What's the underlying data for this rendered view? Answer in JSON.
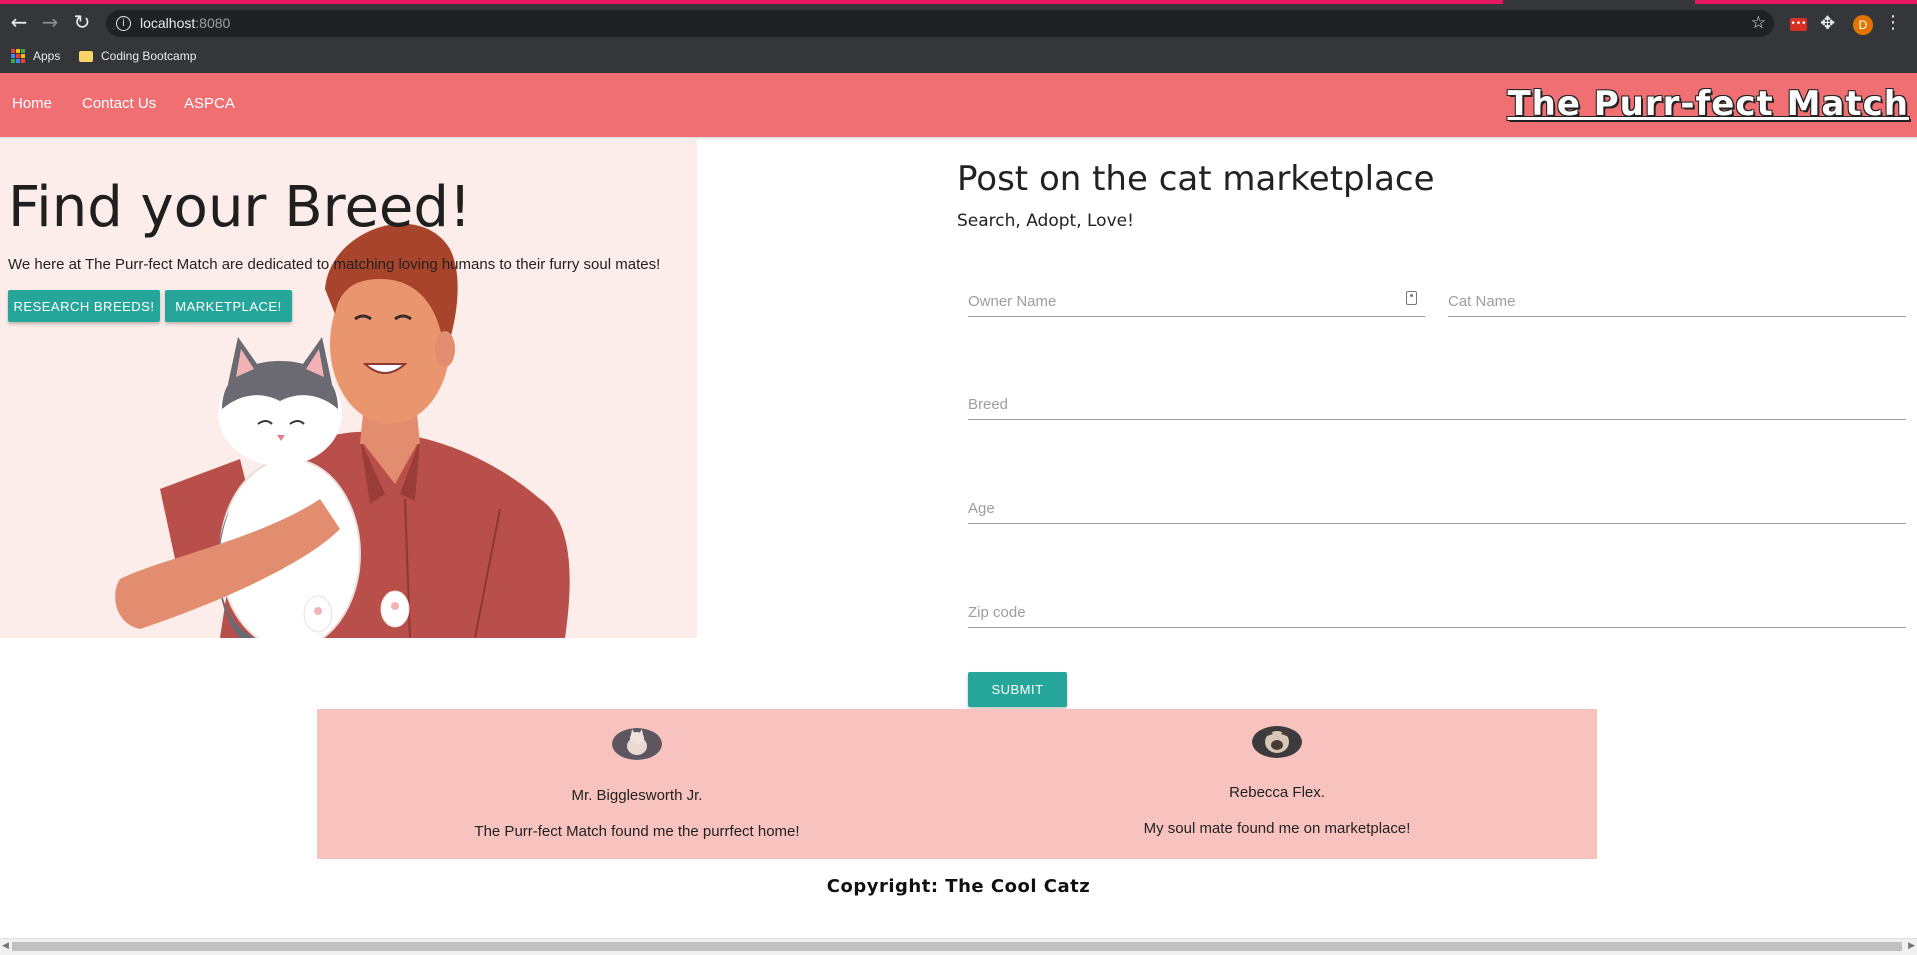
{
  "browser": {
    "url_host": "localhost",
    "url_port": ":8080",
    "bookmarks": [
      "Apps",
      "Coding Bootcamp"
    ],
    "profile_initial": "D",
    "accent_color": "#e8175d"
  },
  "nav": {
    "links": [
      "Home",
      "Contact Us",
      "ASPCA"
    ],
    "brand": "The Purr-fect Match",
    "color": "#ef6f73"
  },
  "hero": {
    "title": "Find your Breed!",
    "subtitle": "We here at The Purr-fect Match are dedicated to matching loving humans to their furry soul mates!",
    "buttons": [
      "Research Breeds!",
      "Marketplace!"
    ],
    "button_color": "#26a69a"
  },
  "form": {
    "title": "Post on the cat marketplace",
    "subtitle": "Search, Adopt, Love!",
    "fields": {
      "owner_name": "Owner Name",
      "cat_name": "Cat Name",
      "breed": "Breed",
      "age": "Age",
      "zip": "Zip code"
    },
    "submit": "Submit"
  },
  "testimonials": [
    {
      "name": "Mr. Bigglesworth Jr.",
      "quote": "The Purr-fect Match found me the purrfect home!"
    },
    {
      "name": "Rebecca Flex.",
      "quote": "My soul mate found me on marketplace!"
    }
  ],
  "footer": {
    "copyright": "Copyright: The Cool Catz"
  }
}
